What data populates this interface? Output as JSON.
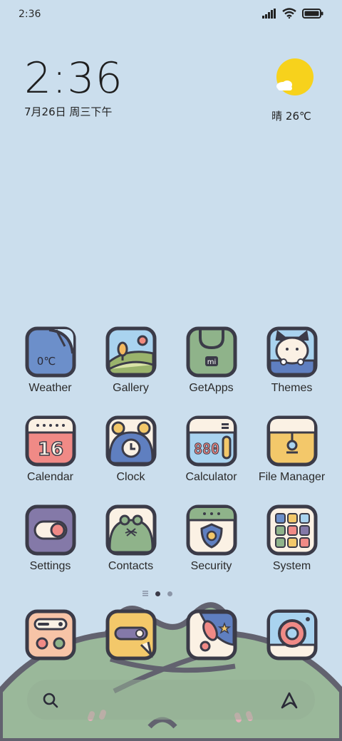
{
  "status_bar": {
    "time": "2:36"
  },
  "clock_widget": {
    "time": "2:36",
    "date": "7月26日 周三下午"
  },
  "weather_widget": {
    "text": "晴 26℃"
  },
  "apps": [
    {
      "label": "Weather",
      "icon": "weather-icon"
    },
    {
      "label": "Gallery",
      "icon": "gallery-icon"
    },
    {
      "label": "GetApps",
      "icon": "getapps-icon"
    },
    {
      "label": "Themes",
      "icon": "themes-icon"
    },
    {
      "label": "Calendar",
      "icon": "calendar-icon"
    },
    {
      "label": "Clock",
      "icon": "clock-icon"
    },
    {
      "label": "Calculator",
      "icon": "calculator-icon"
    },
    {
      "label": "File Manager",
      "icon": "file-manager-icon"
    },
    {
      "label": "Settings",
      "icon": "settings-icon"
    },
    {
      "label": "Contacts",
      "icon": "contacts-icon"
    },
    {
      "label": "Security",
      "icon": "security-icon"
    },
    {
      "label": "System",
      "icon": "system-folder-icon"
    }
  ],
  "icon_text": {
    "weather_temp": "0℃",
    "calendar_day": "16",
    "calculator_digits": "880",
    "getapps_logo": "mi"
  },
  "dock": [
    {
      "icon": "phone-icon"
    },
    {
      "icon": "messages-icon"
    },
    {
      "icon": "browser-icon"
    },
    {
      "icon": "camera-icon"
    }
  ],
  "page_indicator": {
    "pages": 2,
    "current": 1
  },
  "search_bar": {
    "icons": [
      "search-icon",
      "assistant-icon"
    ]
  },
  "colors": {
    "background": "#cbdeed",
    "frog": "#9ab89a",
    "outline": "#3b3b48"
  }
}
